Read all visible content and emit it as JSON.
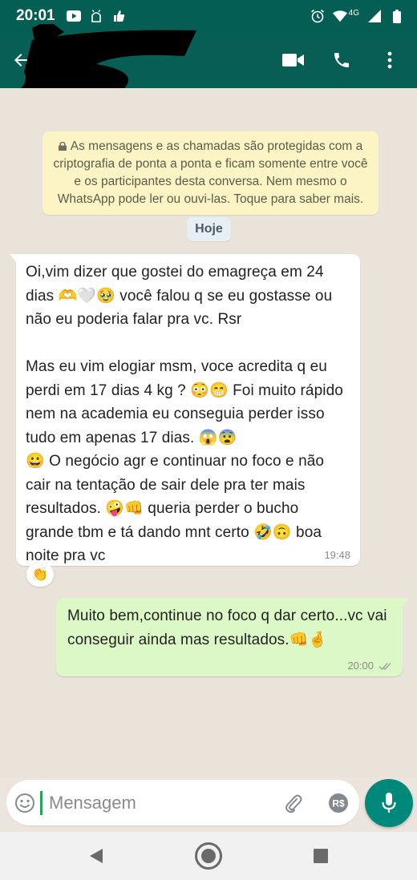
{
  "status_bar": {
    "time": "20:01",
    "network": "4G",
    "icons": [
      "youtube-icon",
      "android-debug-icon",
      "thumbs-up-icon",
      "alarm-icon",
      "wifi-icon",
      "signal-icon",
      "battery-icon"
    ]
  },
  "header": {
    "contact_name": "",
    "icons": [
      "back-arrow-icon",
      "video-call-icon",
      "phone-icon",
      "more-vert-icon"
    ],
    "color": "#075e54"
  },
  "chat": {
    "encryption_notice": "As mensagens e as chamadas são protegidas com a criptografia de ponta a ponta e ficam somente entre você e os participantes desta conversa. Nem mesmo o WhatsApp pode ler ou ouvi-las. Toque para saber mais.",
    "date_label": "Hoje",
    "messages": [
      {
        "direction": "incoming",
        "text": "Oi,vim dizer que gostei do emagreça em 24 dias 🫶🤍🥹 você falou q se eu gostasse ou não eu poderia falar pra vc. Rsr\n\n Mas eu vim elogiar msm, voce acredita q eu perdi em 17 dias 4 kg ? 😳😁 Foi muito rápido nem na academia eu conseguia perder isso tudo em apenas 17 dias. 😱😨\n😀 O negócio agr e continuar no foco e não cair na tentação de sair dele pra ter mais resultados. 🤪👊  queria perder o bucho grande tbm e tá dando mnt certo  🤣🙃 boa noite pra vc",
        "time": "19:48",
        "reaction": "👏"
      },
      {
        "direction": "outgoing",
        "text": "Muito bem,continue no foco q dar certo...vc vai conseguir ainda mas resultados.👊🤞",
        "time": "20:00",
        "status": "delivered"
      }
    ]
  },
  "composer": {
    "placeholder": "Mensagem",
    "value": "",
    "icons": [
      "emoji-icon",
      "attach-icon",
      "payment-icon",
      "camera-icon",
      "mic-icon"
    ],
    "accent": "#00897b"
  },
  "nav_bar": {
    "icons": [
      "back-nav-icon",
      "home-nav-icon",
      "recents-nav-icon"
    ]
  }
}
